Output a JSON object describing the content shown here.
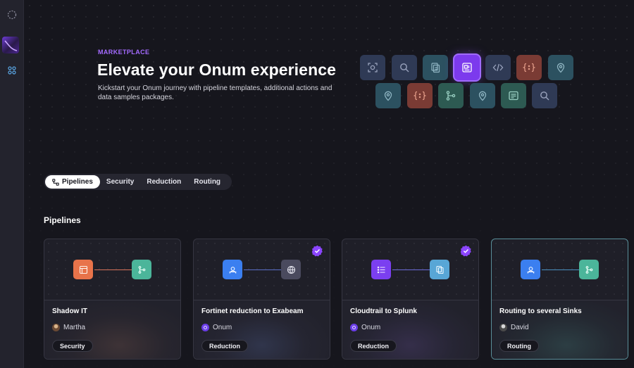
{
  "hero": {
    "eyebrow": "MARKETPLACE",
    "title": "Elevate your Onum experience",
    "description": "Kickstart your Onum journey with pipeline templates, additional actions and data samples packages."
  },
  "mosaic": {
    "row1": [
      "camera-scan-icon",
      "search-icon",
      "documents-icon",
      "data-widget-icon",
      "code-icon",
      "json-braces-icon",
      "location-pin-icon"
    ],
    "row2": [
      "location-pin-icon",
      "json-braces-icon",
      "branch-icon",
      "location-pin-icon",
      "list-card-icon",
      "search-icon"
    ],
    "highlight": "data-widget-icon"
  },
  "tabs": [
    {
      "label": "Pipelines",
      "active": true
    },
    {
      "label": "Security",
      "active": false
    },
    {
      "label": "Reduction",
      "active": false
    },
    {
      "label": "Routing",
      "active": false
    }
  ],
  "section": {
    "title": "Pipelines"
  },
  "cards": [
    {
      "title": "Shadow IT",
      "author": "Martha",
      "tag": "Security",
      "verified": false,
      "from_color": "#e8734a",
      "to_color": "#4bb59a"
    },
    {
      "title": "Fortinet reduction to Exabeam",
      "author": "Onum",
      "tag": "Reduction",
      "verified": true,
      "from_color": "#3b7ff0",
      "to_color": "#4a4a5e"
    },
    {
      "title": "Cloudtrail to Splunk",
      "author": "Onum",
      "tag": "Reduction",
      "verified": true,
      "from_color": "#7b3ff0",
      "to_color": "#58a6d6"
    },
    {
      "title": "Routing to several Sinks",
      "author": "David",
      "tag": "Routing",
      "verified": false,
      "from_color": "#3b7ff0",
      "to_color": "#4bb59a"
    }
  ],
  "colors": {
    "accent": "#7c3aed",
    "eyebrow": "#a46bff",
    "background": "#16161d"
  }
}
